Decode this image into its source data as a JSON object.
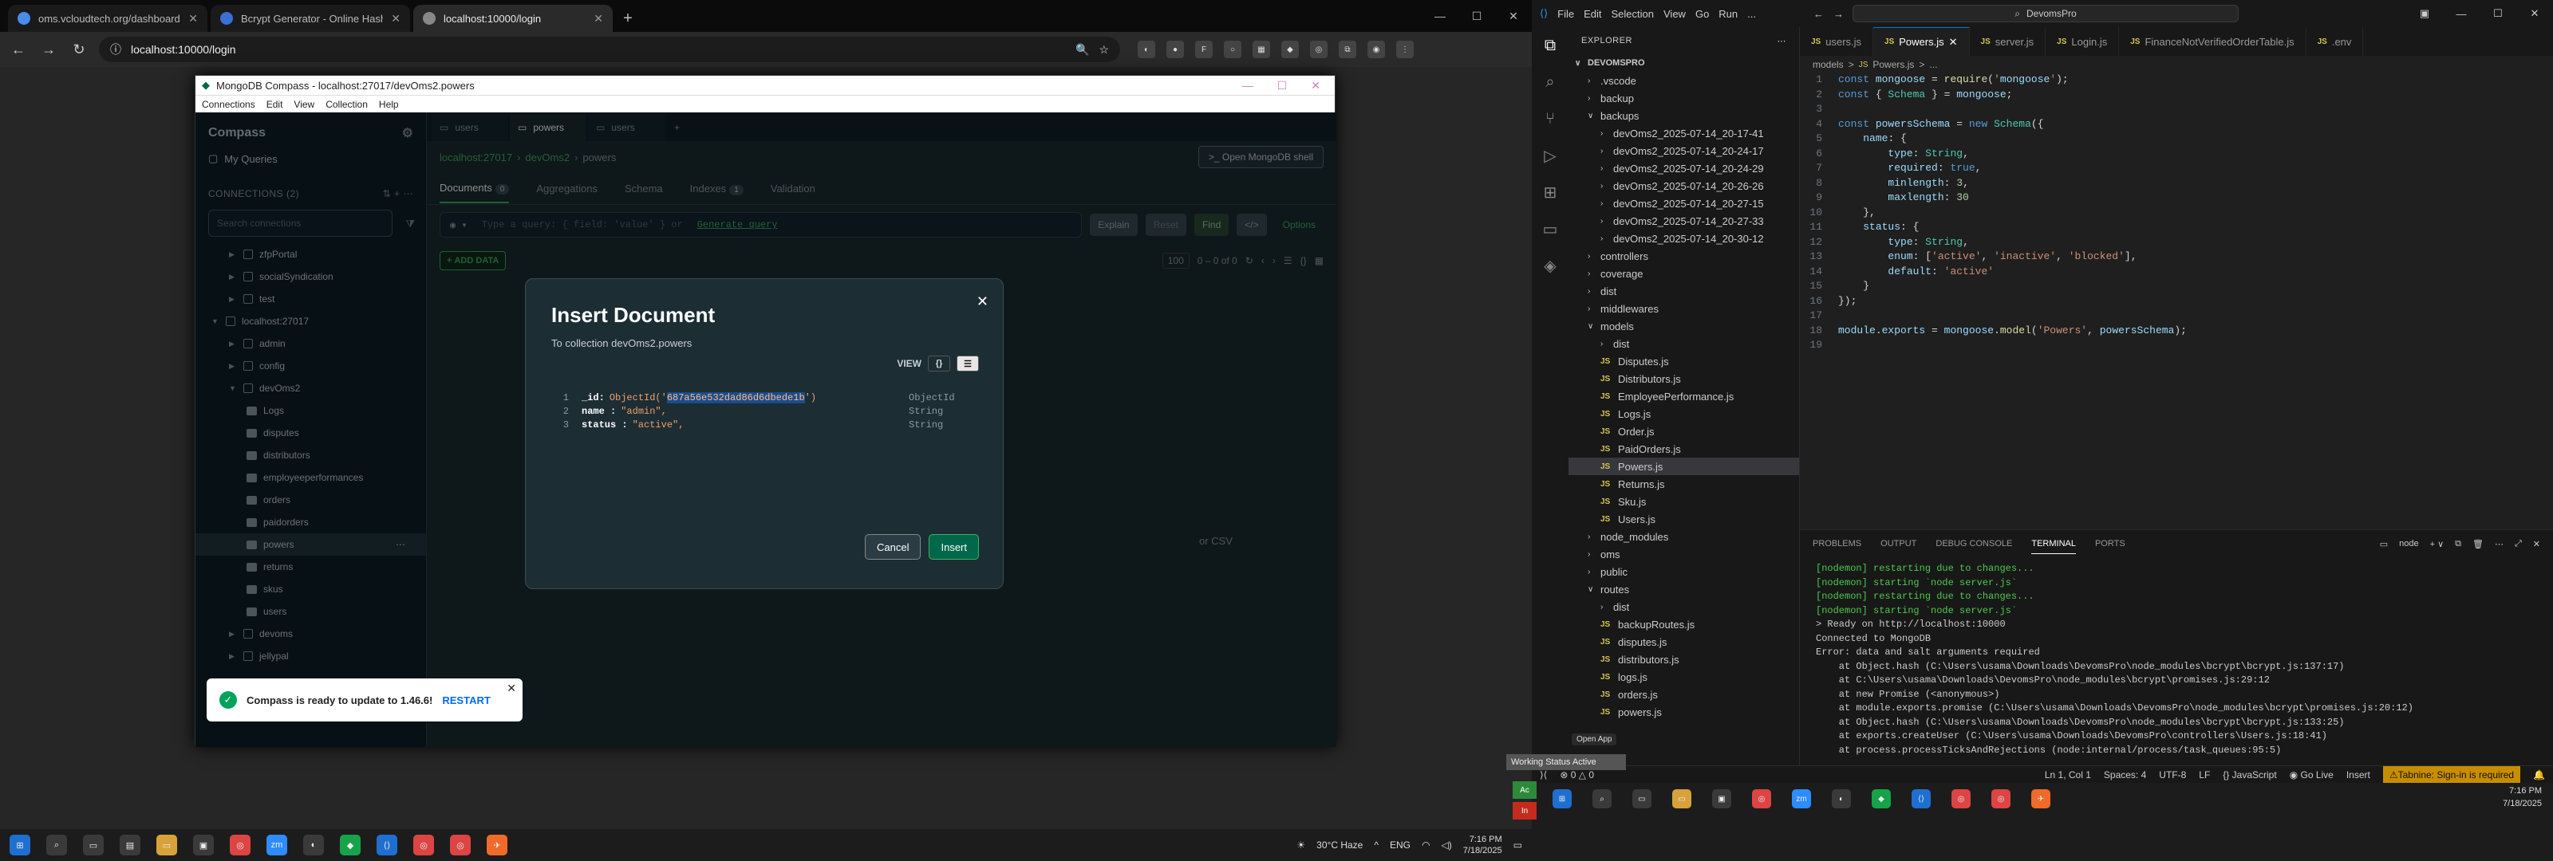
{
  "browser": {
    "tabs": [
      {
        "title": "oms.vcloudtech.org/dashboard",
        "active": false
      },
      {
        "title": "Bcrypt Generator - Online Hash",
        "active": false
      },
      {
        "title": "localhost:10000/login",
        "active": true
      }
    ],
    "url": "localhost:10000/login"
  },
  "compass": {
    "window_title": "MongoDB Compass - localhost:27017/devOms2.powers",
    "menu": [
      "Connections",
      "Edit",
      "View",
      "Collection",
      "Help"
    ],
    "sidebar": {
      "title": "Compass",
      "my_queries": "My Queries",
      "connections_label": "CONNECTIONS (2)",
      "search_placeholder": "Search connections",
      "tree": [
        {
          "label": "zfpPortal",
          "indent": 1,
          "kind": "db",
          "open": false
        },
        {
          "label": "socialSyndication",
          "indent": 1,
          "kind": "db",
          "open": false
        },
        {
          "label": "test",
          "indent": 1,
          "kind": "db",
          "open": false
        },
        {
          "label": "localhost:27017",
          "indent": 0,
          "kind": "conn",
          "open": true
        },
        {
          "label": "admin",
          "indent": 1,
          "kind": "db",
          "open": false
        },
        {
          "label": "config",
          "indent": 1,
          "kind": "db",
          "open": false
        },
        {
          "label": "devOms2",
          "indent": 1,
          "kind": "db",
          "open": true
        },
        {
          "label": "Logs",
          "indent": 2,
          "kind": "coll"
        },
        {
          "label": "disputes",
          "indent": 2,
          "kind": "coll"
        },
        {
          "label": "distributors",
          "indent": 2,
          "kind": "coll"
        },
        {
          "label": "employeeperformances",
          "indent": 2,
          "kind": "coll"
        },
        {
          "label": "orders",
          "indent": 2,
          "kind": "coll"
        },
        {
          "label": "paidorders",
          "indent": 2,
          "kind": "coll"
        },
        {
          "label": "powers",
          "indent": 2,
          "kind": "coll",
          "selected": true
        },
        {
          "label": "returns",
          "indent": 2,
          "kind": "coll"
        },
        {
          "label": "skus",
          "indent": 2,
          "kind": "coll"
        },
        {
          "label": "users",
          "indent": 2,
          "kind": "coll"
        },
        {
          "label": "devoms",
          "indent": 1,
          "kind": "db",
          "open": false
        },
        {
          "label": "jellypal",
          "indent": 1,
          "kind": "db",
          "open": false
        }
      ]
    },
    "tabs": [
      "users",
      "powers",
      "users"
    ],
    "breadcrumb": [
      "localhost:27017",
      "devOms2",
      "powers"
    ],
    "shell_button": "Open MongoDB shell",
    "subtabs": [
      {
        "label": "Documents",
        "count": "0"
      },
      {
        "label": "Aggregations"
      },
      {
        "label": "Schema"
      },
      {
        "label": "Indexes",
        "count": "1"
      },
      {
        "label": "Validation"
      }
    ],
    "query_placeholder": "Type a query: { field: 'value' } or",
    "generate_query": "Generate query",
    "query_buttons": {
      "explain": "Explain",
      "reset": "Reset",
      "find": "Find",
      "options": "Options"
    },
    "add_data": "ADD DATA",
    "page_size": "100",
    "range": "0 – 0 of 0",
    "csv_text": "or CSV"
  },
  "modal": {
    "title": "Insert Document",
    "subtitle": "To collection devOms2.powers",
    "view_label": "VIEW",
    "lines": [
      {
        "num": "1",
        "key": "_id:",
        "prefix": "ObjectId('",
        "value": "687a56e532dad86d6dbede1b",
        "suffix": "')",
        "type": "ObjectId"
      },
      {
        "num": "2",
        "key": "name :",
        "prefix": "\"admin\",",
        "value": "",
        "suffix": "",
        "type": "String"
      },
      {
        "num": "3",
        "key": "status :",
        "prefix": "\"active\",",
        "value": "",
        "suffix": "",
        "type": "String"
      }
    ],
    "cancel": "Cancel",
    "insert": "Insert"
  },
  "toast": {
    "text": "Compass is ready to update to 1.46.6!",
    "action": "RESTART"
  },
  "left_taskbar": {
    "weather": "30°C  Haze",
    "lang": "ENG",
    "time": "7:16 PM",
    "date": "7/18/2025"
  },
  "vscode": {
    "search": "DevomsPro",
    "menu": [
      "File",
      "Edit",
      "Selection",
      "View",
      "Go",
      "Run",
      "..."
    ],
    "explorer_title": "EXPLORER",
    "root": "DEVOMSPRO",
    "tree": [
      {
        "label": ".vscode",
        "indent": 1,
        "kind": "folder",
        "open": false
      },
      {
        "label": "backup",
        "indent": 1,
        "kind": "folder",
        "open": false
      },
      {
        "label": "backups",
        "indent": 1,
        "kind": "folder",
        "open": true
      },
      {
        "label": "devOms2_2025-07-14_20-17-41",
        "indent": 2,
        "kind": "folder",
        "open": false
      },
      {
        "label": "devOms2_2025-07-14_20-24-17",
        "indent": 2,
        "kind": "folder",
        "open": false
      },
      {
        "label": "devOms2_2025-07-14_20-24-29",
        "indent": 2,
        "kind": "folder",
        "open": false
      },
      {
        "label": "devOms2_2025-07-14_20-26-26",
        "indent": 2,
        "kind": "folder",
        "open": false
      },
      {
        "label": "devOms2_2025-07-14_20-27-15",
        "indent": 2,
        "kind": "folder",
        "open": false
      },
      {
        "label": "devOms2_2025-07-14_20-27-33",
        "indent": 2,
        "kind": "folder",
        "open": false
      },
      {
        "label": "devOms2_2025-07-14_20-30-12",
        "indent": 2,
        "kind": "folder",
        "open": false
      },
      {
        "label": "controllers",
        "indent": 1,
        "kind": "folder",
        "open": false
      },
      {
        "label": "coverage",
        "indent": 1,
        "kind": "folder",
        "open": false
      },
      {
        "label": "dist",
        "indent": 1,
        "kind": "folder",
        "open": false
      },
      {
        "label": "middlewares",
        "indent": 1,
        "kind": "folder",
        "open": false
      },
      {
        "label": "models",
        "indent": 1,
        "kind": "folder",
        "open": true
      },
      {
        "label": "dist",
        "indent": 2,
        "kind": "folder",
        "open": false
      },
      {
        "label": "Disputes.js",
        "indent": 2,
        "kind": "js"
      },
      {
        "label": "Distributors.js",
        "indent": 2,
        "kind": "js"
      },
      {
        "label": "EmployeePerformance.js",
        "indent": 2,
        "kind": "js"
      },
      {
        "label": "Logs.js",
        "indent": 2,
        "kind": "js"
      },
      {
        "label": "Order.js",
        "indent": 2,
        "kind": "js"
      },
      {
        "label": "PaidOrders.js",
        "indent": 2,
        "kind": "js"
      },
      {
        "label": "Powers.js",
        "indent": 2,
        "kind": "js",
        "selected": true
      },
      {
        "label": "Returns.js",
        "indent": 2,
        "kind": "js"
      },
      {
        "label": "Sku.js",
        "indent": 2,
        "kind": "js"
      },
      {
        "label": "Users.js",
        "indent": 2,
        "kind": "js"
      },
      {
        "label": "node_modules",
        "indent": 1,
        "kind": "folder",
        "open": false
      },
      {
        "label": "oms",
        "indent": 1,
        "kind": "folder",
        "open": false
      },
      {
        "label": "public",
        "indent": 1,
        "kind": "folder",
        "open": false
      },
      {
        "label": "routes",
        "indent": 1,
        "kind": "folder",
        "open": true
      },
      {
        "label": "dist",
        "indent": 2,
        "kind": "folder",
        "open": false
      },
      {
        "label": "backupRoutes.js",
        "indent": 2,
        "kind": "js"
      },
      {
        "label": "disputes.js",
        "indent": 2,
        "kind": "js"
      },
      {
        "label": "distributors.js",
        "indent": 2,
        "kind": "js"
      },
      {
        "label": "logs.js",
        "indent": 2,
        "kind": "js"
      },
      {
        "label": "orders.js",
        "indent": 2,
        "kind": "js"
      },
      {
        "label": "powers.js",
        "indent": 2,
        "kind": "js"
      }
    ],
    "editor_tabs": [
      {
        "label": "users.js",
        "active": false
      },
      {
        "label": "Powers.js",
        "active": true
      },
      {
        "label": "server.js",
        "active": false
      },
      {
        "label": "Login.js",
        "active": false
      },
      {
        "label": "FinanceNotVerifiedOrderTable.js",
        "active": false
      },
      {
        "label": ".env",
        "active": false
      }
    ],
    "breadcrumb": [
      "models",
      ">",
      "Powers.js",
      ">",
      "..."
    ],
    "code": [
      "const mongoose = require('mongoose');",
      "const { Schema } = mongoose;",
      "",
      "const powersSchema = new Schema({",
      "    name: {",
      "        type: String,",
      "        required: true,",
      "        minlength: 3,",
      "        maxlength: 30",
      "    },",
      "    status: {",
      "        type: String,",
      "        enum: ['active', 'inactive', 'blocked'],",
      "        default: 'active'",
      "    }",
      "});",
      "",
      "module.exports = mongoose.model('Powers', powersSchema);",
      ""
    ],
    "panel_tabs": [
      "PROBLEMS",
      "OUTPUT",
      "DEBUG CONSOLE",
      "TERMINAL",
      "PORTS"
    ],
    "terminal_kind": "node",
    "terminal": [
      {
        "text": "[nodemon] restarting due to changes...",
        "green": true
      },
      {
        "text": "[nodemon] starting `node server.js`",
        "green": true
      },
      {
        "text": "[nodemon] restarting due to changes...",
        "green": true
      },
      {
        "text": "[nodemon] starting `node server.js`",
        "green": true
      },
      {
        "text": "> Ready on http://localhost:10000",
        "green": false
      },
      {
        "text": "Connected to MongoDB",
        "green": false
      },
      {
        "text": "Error: data and salt arguments required",
        "green": false
      },
      {
        "text": "    at Object.hash (C:\\Users\\usama\\Downloads\\DevomsPro\\node_modules\\bcrypt\\bcrypt.js:137:17)",
        "green": false
      },
      {
        "text": "    at C:\\Users\\usama\\Downloads\\DevomsPro\\node_modules\\bcrypt\\promises.js:29:12",
        "green": false
      },
      {
        "text": "    at new Promise (<anonymous>)",
        "green": false
      },
      {
        "text": "    at module.exports.promise (C:\\Users\\usama\\Downloads\\DevomsPro\\node_modules\\bcrypt\\promises.js:20:12)",
        "green": false
      },
      {
        "text": "    at Object.hash (C:\\Users\\usama\\Downloads\\DevomsPro\\node_modules\\bcrypt\\bcrypt.js:133:25)",
        "green": false
      },
      {
        "text": "    at exports.createUser (C:\\Users\\usama\\Downloads\\DevomsPro\\controllers\\Users.js:18:41)",
        "green": false
      },
      {
        "text": "    at process.processTicksAndRejections (node:internal/process/task_queues:95:5)",
        "green": false
      }
    ],
    "status": {
      "cursor": "Ln 1, Col 1",
      "spaces": "Spaces: 4",
      "encoding": "UTF-8",
      "eol": "LF",
      "lang": "{} JavaScript",
      "golive": "Go Live",
      "mode": "Insert",
      "tabnine": "Tabnine: Sign-in is required"
    },
    "open_app": "Open App",
    "working_status": "Working Status Active",
    "right_time": "7:16 PM",
    "right_date": "7/18/2025"
  }
}
